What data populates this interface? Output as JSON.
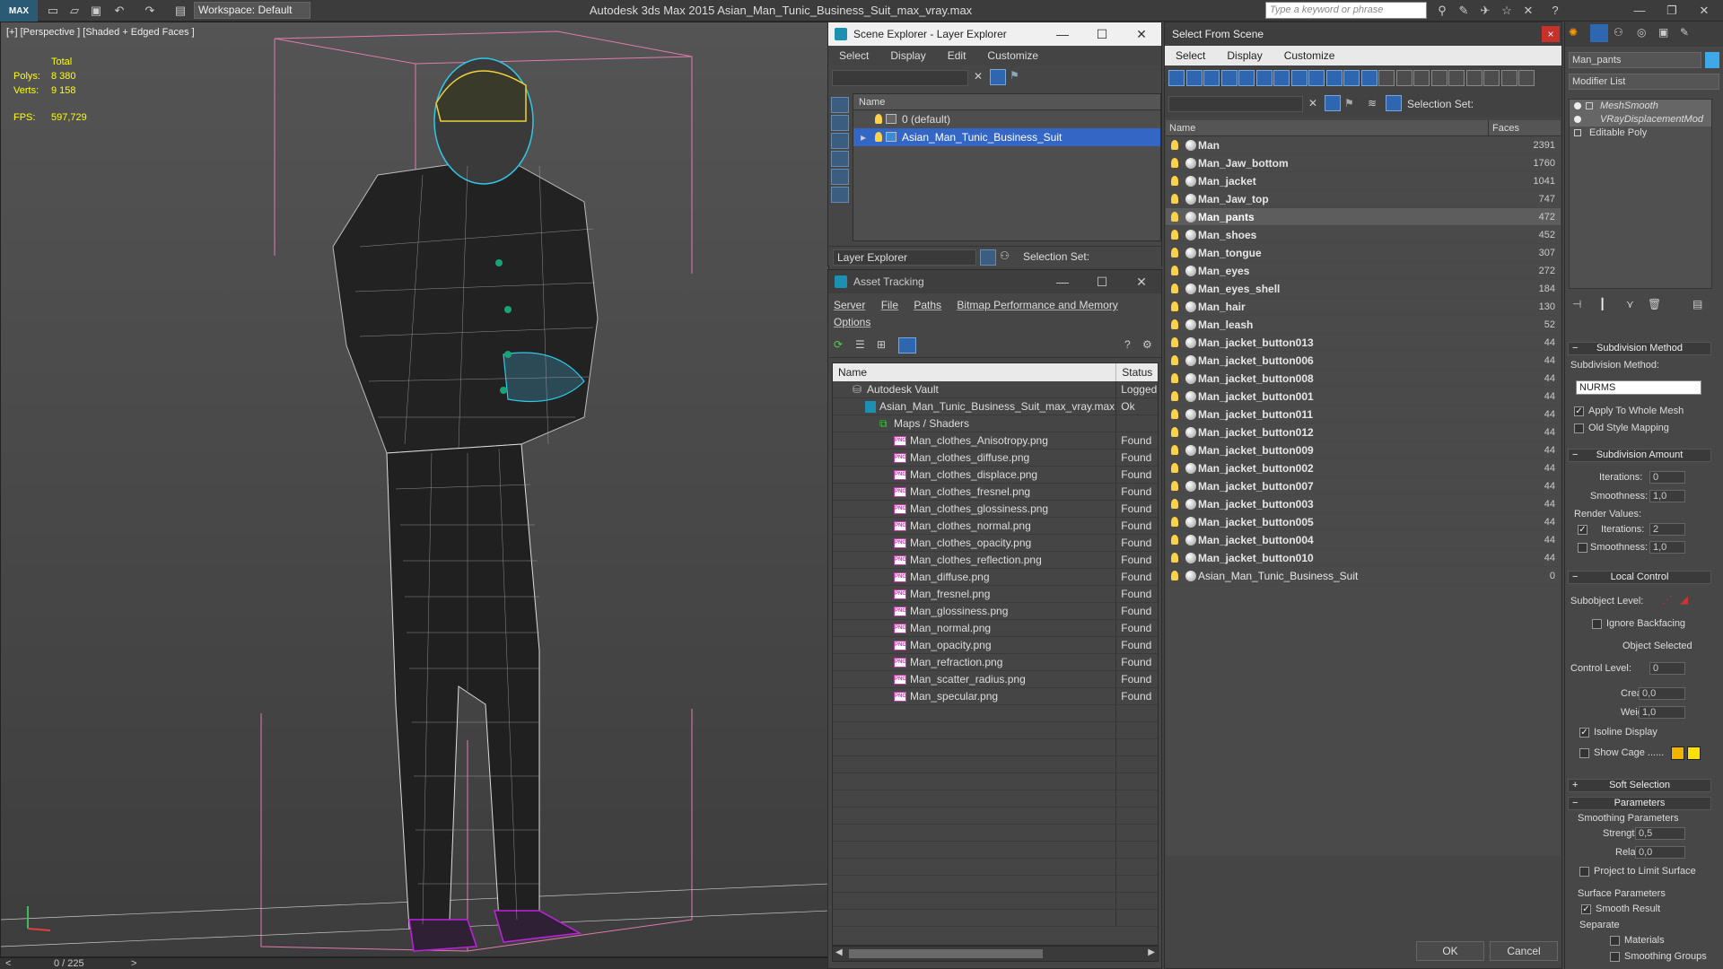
{
  "app": {
    "logo": "MAX",
    "workspace": "Workspace: Default",
    "title": "Autodesk 3ds Max  2015    Asian_Man_Tunic_Business_Suit_max_vray.max",
    "search_placeholder": "Type a keyword or phrase"
  },
  "viewport": {
    "label": "[+] [Perspective ] [Shaded + Edged Faces ]",
    "stats_header": "Total",
    "polys_label": "Polys:",
    "polys": "8 380",
    "verts_label": "Verts:",
    "verts": "9 158",
    "fps_label": "FPS:",
    "fps": "597,729",
    "timeline": "0 / 225"
  },
  "scene_explorer": {
    "title": "Scene Explorer - Layer Explorer",
    "menu": [
      "Select",
      "Display",
      "Edit",
      "Customize"
    ],
    "col_name": "Name",
    "rows": [
      {
        "label": "0 (default)",
        "selected": false
      },
      {
        "label": "Asian_Man_Tunic_Business_Suit",
        "selected": true
      }
    ],
    "footer_dropdown": "Layer Explorer",
    "selection_set": "Selection Set:"
  },
  "asset_tracking": {
    "title": "Asset Tracking",
    "menu": [
      "Server",
      "File",
      "Paths",
      "Bitmap Performance and Memory",
      "Options"
    ],
    "col_name": "Name",
    "col_status": "Status",
    "vault": {
      "name": "Autodesk Vault",
      "status": "Logged"
    },
    "file": {
      "name": "Asian_Man_Tunic_Business_Suit_max_vray.max",
      "status": "Ok"
    },
    "group": "Maps / Shaders",
    "maps": [
      {
        "name": "Man_clothes_Anisotropy.png",
        "status": "Found"
      },
      {
        "name": "Man_clothes_diffuse.png",
        "status": "Found"
      },
      {
        "name": "Man_clothes_displace.png",
        "status": "Found"
      },
      {
        "name": "Man_clothes_fresnel.png",
        "status": "Found"
      },
      {
        "name": "Man_clothes_glossiness.png",
        "status": "Found"
      },
      {
        "name": "Man_clothes_normal.png",
        "status": "Found"
      },
      {
        "name": "Man_clothes_opacity.png",
        "status": "Found"
      },
      {
        "name": "Man_clothes_reflection.png",
        "status": "Found"
      },
      {
        "name": "Man_diffuse.png",
        "status": "Found"
      },
      {
        "name": "Man_fresnel.png",
        "status": "Found"
      },
      {
        "name": "Man_glossiness.png",
        "status": "Found"
      },
      {
        "name": "Man_normal.png",
        "status": "Found"
      },
      {
        "name": "Man_opacity.png",
        "status": "Found"
      },
      {
        "name": "Man_refraction.png",
        "status": "Found"
      },
      {
        "name": "Man_scatter_radius.png",
        "status": "Found"
      },
      {
        "name": "Man_specular.png",
        "status": "Found"
      }
    ],
    "png_tag": "PNG"
  },
  "select_from_scene": {
    "title": "Select From Scene",
    "close": "×",
    "menu": [
      "Select",
      "Display",
      "Customize"
    ],
    "selection_set": "Selection Set:",
    "col_name": "Name",
    "col_faces": "Faces",
    "rows": [
      {
        "name": "Man",
        "faces": "2391",
        "selected": false
      },
      {
        "name": "Man_Jaw_bottom",
        "faces": "1760",
        "selected": false
      },
      {
        "name": "Man_jacket",
        "faces": "1041",
        "selected": false
      },
      {
        "name": "Man_Jaw_top",
        "faces": "747",
        "selected": false
      },
      {
        "name": "Man_pants",
        "faces": "472",
        "selected": true
      },
      {
        "name": "Man_shoes",
        "faces": "452",
        "selected": false
      },
      {
        "name": "Man_tongue",
        "faces": "307",
        "selected": false
      },
      {
        "name": "Man_eyes",
        "faces": "272",
        "selected": false
      },
      {
        "name": "Man_eyes_shell",
        "faces": "184",
        "selected": false
      },
      {
        "name": "Man_hair",
        "faces": "130",
        "selected": false
      },
      {
        "name": "Man_leash",
        "faces": "52",
        "selected": false
      },
      {
        "name": "Man_jacket_button013",
        "faces": "44",
        "selected": false
      },
      {
        "name": "Man_jacket_button006",
        "faces": "44",
        "selected": false
      },
      {
        "name": "Man_jacket_button008",
        "faces": "44",
        "selected": false
      },
      {
        "name": "Man_jacket_button001",
        "faces": "44",
        "selected": false
      },
      {
        "name": "Man_jacket_button011",
        "faces": "44",
        "selected": false
      },
      {
        "name": "Man_jacket_button012",
        "faces": "44",
        "selected": false
      },
      {
        "name": "Man_jacket_button009",
        "faces": "44",
        "selected": false
      },
      {
        "name": "Man_jacket_button002",
        "faces": "44",
        "selected": false
      },
      {
        "name": "Man_jacket_button007",
        "faces": "44",
        "selected": false
      },
      {
        "name": "Man_jacket_button003",
        "faces": "44",
        "selected": false
      },
      {
        "name": "Man_jacket_button005",
        "faces": "44",
        "selected": false
      },
      {
        "name": "Man_jacket_button004",
        "faces": "44",
        "selected": false
      },
      {
        "name": "Man_jacket_button010",
        "faces": "44",
        "selected": false
      },
      {
        "name": "Asian_Man_Tunic_Business_Suit",
        "faces": "0",
        "selected": false
      }
    ],
    "ok": "OK",
    "cancel": "Cancel"
  },
  "command_panel": {
    "object_name": "Man_pants",
    "modifier_list": "Modifier List",
    "stack": [
      "MeshSmooth",
      "VRayDisplacementMod",
      "Editable Poly"
    ],
    "subdivision_method_rollout": "Subdivision Method",
    "subdivision_method_label": "Subdivision Method:",
    "subdivision_method_value": "NURMS",
    "apply_whole_mesh": "Apply To Whole Mesh",
    "old_style_mapping": "Old Style Mapping",
    "subdivision_amount_rollout": "Subdivision Amount",
    "iterations_label": "Iterations:",
    "iterations": "0",
    "smoothness_label": "Smoothness:",
    "smoothness": "1,0",
    "render_values": "Render Values:",
    "render_iterations_label": "Iterations:",
    "render_iterations": "2",
    "render_smoothness_label": "Smoothness:",
    "render_smoothness": "1,0",
    "local_control_rollout": "Local Control",
    "subobject_level": "Subobject Level:",
    "ignore_backfacing": "Ignore Backfacing",
    "object_selected": "Object Selected",
    "control_level_label": "Control Level:",
    "control_level": "0",
    "crease_label": "Crease:",
    "crease": "0,0",
    "weight_label": "Weight:",
    "weight": "1,0",
    "isoline_display": "Isoline Display",
    "show_cage": "Show Cage ......",
    "soft_selection_rollout": "Soft Selection",
    "parameters_rollout": "Parameters",
    "smoothing_parameters": "Smoothing Parameters",
    "strength_label": "Strength:",
    "strength": "0,5",
    "relax_label": "Relax:",
    "relax": "0,0",
    "project_limit": "Project to Limit Surface",
    "surface_parameters": "Surface Parameters",
    "smooth_result": "Smooth Result",
    "separate": "Separate",
    "materials": "Materials",
    "smoothing_groups": "Smoothing Groups",
    "cage_color_1": "#f0b400",
    "cage_color_2": "#ffe000"
  }
}
